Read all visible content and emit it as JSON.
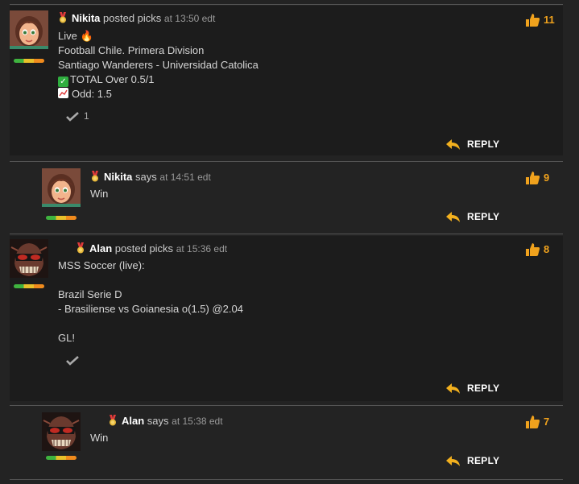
{
  "colors": {
    "accent": "#f0a21d",
    "reply": "#ffffff",
    "bg": "#1c1c1c"
  },
  "comments": [
    {
      "author": "Nikita",
      "verb": "posted picks",
      "time": "at 13:50 edt",
      "likes": "11",
      "avatar": "girl-avatar",
      "lines": [
        "Live 🔥",
        "Football Chile. Primera Division",
        "Santiago Wanderers - Universidad Catolica",
        "TOTAL Over 0.5/1",
        "Odd: 1.5"
      ],
      "check_count": "1",
      "reply": "REPLY"
    },
    {
      "author": "Nikita",
      "verb": "says",
      "time": "at 14:51 edt",
      "likes": "9",
      "avatar": "girl-avatar",
      "lines": [
        "Win"
      ],
      "reply": "REPLY"
    },
    {
      "author": "Alan",
      "verb": "posted picks",
      "time": "at 15:36 edt",
      "likes": "8",
      "avatar": "skull-avatar",
      "lines": [
        "MSS Soccer (live):",
        "",
        "Brazil Serie D",
        "- Brasiliense vs Goianesia o(1.5) @2.04",
        "",
        "GL!"
      ],
      "reply": "REPLY"
    },
    {
      "author": "Alan",
      "verb": "says",
      "time": "at 15:38 edt",
      "likes": "7",
      "avatar": "skull-avatar",
      "lines": [
        "Win"
      ],
      "reply": "REPLY"
    }
  ]
}
